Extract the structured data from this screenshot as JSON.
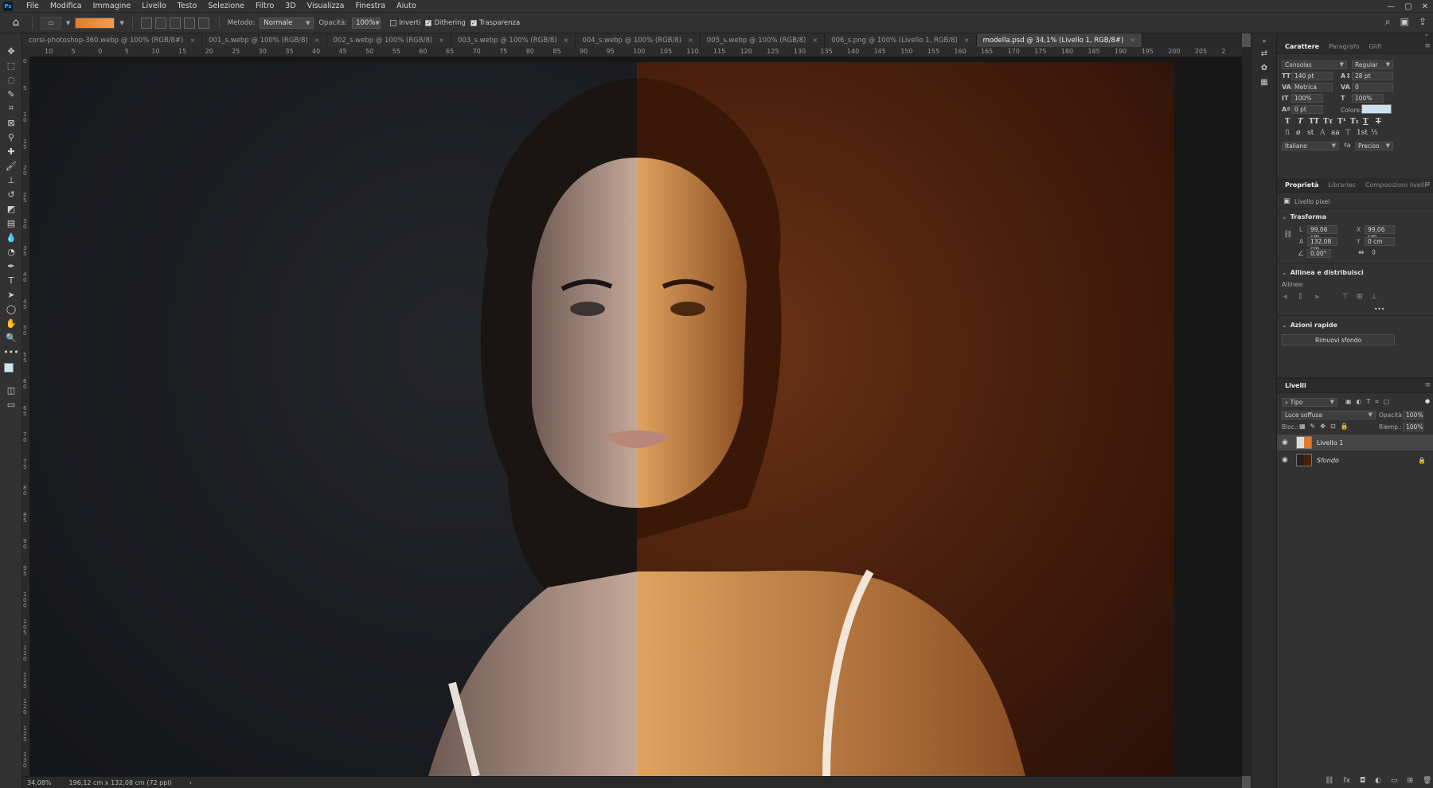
{
  "app": {
    "logo": "Ps"
  },
  "menu": [
    "File",
    "Modifica",
    "Immagine",
    "Livello",
    "Testo",
    "Selezione",
    "Filtro",
    "3D",
    "Visualizza",
    "Finestra",
    "Aiuto"
  ],
  "options": {
    "metodo_label": "Metodo:",
    "metodo_value": "Normale",
    "opacita_label": "Opacità:",
    "opacita_value": "100%",
    "inverti": "Inverti",
    "dithering": "Dithering",
    "trasparenza": "Trasparenza",
    "inverti_checked": false,
    "dithering_checked": true,
    "trasparenza_checked": true,
    "gradient_colors": [
      "#e07b2e",
      "#f0a050"
    ]
  },
  "tabs": [
    {
      "label": "corsi-photoshop-360.webp @ 100% (RGB/8#)",
      "active": false
    },
    {
      "label": "001_s.webp @ 100% (RGB/8)",
      "active": false
    },
    {
      "label": "002_s.webp @ 100% (RGB/8)",
      "active": false
    },
    {
      "label": "003_s.webp @ 100% (RGB/8)",
      "active": false
    },
    {
      "label": "004_s.webp @ 100% (RGB/8)",
      "active": false
    },
    {
      "label": "005_s.webp @ 100% (RGB/8)",
      "active": false
    },
    {
      "label": "006_s.png @ 100% (Livello 1, RGB/8)",
      "active": false
    },
    {
      "label": "modella.psd @ 34,1% (Livello 1, RGB/8#)",
      "active": true
    }
  ],
  "ruler_h": [
    "10",
    "5",
    "0",
    "5",
    "10",
    "15",
    "20",
    "25",
    "30",
    "35",
    "40",
    "45",
    "50",
    "55",
    "60",
    "65",
    "70",
    "75",
    "80",
    "85",
    "90",
    "95",
    "100",
    "105",
    "110",
    "115",
    "120",
    "125",
    "130",
    "135",
    "140",
    "145",
    "150",
    "155",
    "160",
    "165",
    "170",
    "175",
    "180",
    "185",
    "190",
    "195",
    "200",
    "205",
    "2"
  ],
  "ruler_v": [
    "0",
    "5",
    "1 0",
    "1 5",
    "2 0",
    "2 5",
    "3 0",
    "3 5",
    "4 0",
    "4 5",
    "5 0",
    "5 5",
    "6 0",
    "6 5",
    "7 0",
    "7 5",
    "8 0",
    "8 5",
    "9 0",
    "9 5",
    "1 0 0",
    "1 0 5",
    "1 1 0",
    "1 1 5",
    "1 2 0",
    "1 2 5",
    "1 3 0"
  ],
  "status": {
    "zoom": "34,08%",
    "size": "196,12 cm x 132,08 cm (72 ppi)"
  },
  "carattere": {
    "tabs": [
      "Carattere",
      "Paragrafo",
      "Glifi"
    ],
    "font": "Consolas",
    "style": "Regular",
    "size": "140 pt",
    "leading": "28 pt",
    "kerning": "Metrica",
    "tracking": "0",
    "vscale": "100%",
    "hscale": "100%",
    "baseline": "0 pt",
    "color_label": "Colore:",
    "color": "#cfe3ee",
    "lang": "Italiano",
    "aa": "Preciso",
    "aa_icon": "ªa"
  },
  "proprieta": {
    "tabs": [
      "Proprietà",
      "Libraries",
      "Composizioni livelli"
    ],
    "layer_type": "Livello pixel",
    "trasforma": "Trasforma",
    "l_label": "L",
    "l": "99,06 cm",
    "x_label": "X",
    "x": "99,06 cm",
    "a_label": "A",
    "a": "132,08 cm",
    "y_label": "Y",
    "y": "0 cm",
    "angle": "0,00°",
    "allinea_section": "Allinea e distribuisci",
    "allinea_label": "Allinea:",
    "azioni": "Azioni rapide",
    "rimuovi": "Rimuovi sfondo",
    "more": "•••"
  },
  "livelli": {
    "title": "Livelli",
    "filter": "Tipo",
    "blend": "Luce soffusa",
    "opacity_label": "Opacità:",
    "opacity": "100%",
    "lock_label": "Bloc.:",
    "fill_label": "Riemp.:",
    "fill": "100%",
    "layers": [
      {
        "name": "Livello 1",
        "selected": true
      },
      {
        "name": "Sfondo",
        "selected": false,
        "locked": true
      }
    ],
    "bottom_icons": [
      "link-icon",
      "fx-icon",
      "mask-icon",
      "adjustment-icon",
      "folder-icon",
      "new-layer-icon",
      "trash-icon"
    ],
    "bottom_labels": [
      "⛓",
      "fx",
      "◘",
      "◐",
      "▭",
      "⊞",
      "🗑"
    ]
  }
}
